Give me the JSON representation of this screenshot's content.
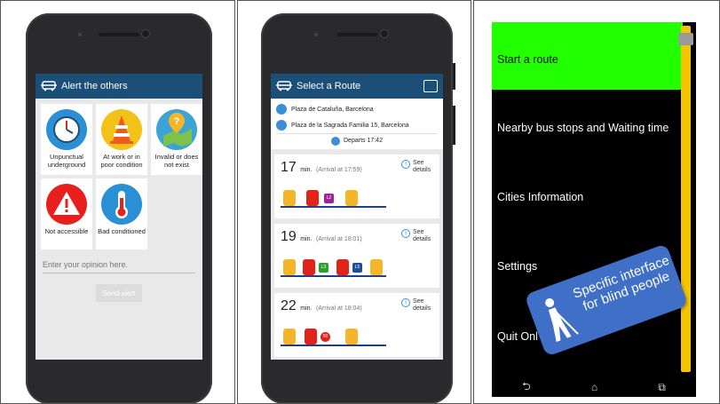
{
  "panel1": {
    "appbar_title": "Alert the others",
    "tiles": [
      {
        "label": "Unpunctual underground",
        "icon": "clock-icon",
        "color": "#2a8fd4"
      },
      {
        "label": "At work or in poor condition",
        "icon": "traffic-cone-icon",
        "color": "#f2c219"
      },
      {
        "label": "Invalid or does not exist",
        "icon": "map-question-icon",
        "color": "#3ba4d4"
      },
      {
        "label": "Not accessible",
        "icon": "warning-icon",
        "color": "#e8201d"
      },
      {
        "label": "Bad conditioned",
        "icon": "thermometer-icon",
        "color": "#2a8fd4"
      }
    ],
    "opinion_placeholder": "Enter your opinion here.",
    "send_label": "Send alert"
  },
  "panel2": {
    "appbar_title": "Select a Route",
    "origin": "Plaza de Cataluña, Barcelona",
    "destination": "Plaza de la Sagrada Familia 15, Barcelona",
    "departs": "Departs 17:42",
    "routes": [
      {
        "minutes": "17",
        "unit": "min.",
        "arrival": "(Arrival at 17:59)",
        "see": "See details",
        "lines": [
          "L2"
        ]
      },
      {
        "minutes": "19",
        "unit": "min.",
        "arrival": "(Arrival at 18:01)",
        "see": "See details",
        "lines": [
          "L3",
          "L5"
        ]
      },
      {
        "minutes": "22",
        "unit": "min.",
        "arrival": "(Arrival at 18:04)",
        "see": "See details",
        "lines": [
          "50"
        ]
      }
    ]
  },
  "panel3": {
    "menu": [
      "Start a route",
      "Nearby bus stops and Waiting time",
      "Cities Information",
      "Settings",
      "Quit Onl"
    ],
    "callout": "Specific interface for blind people",
    "nav": {
      "back": "back-icon",
      "home": "home-icon",
      "recents": "recents-icon"
    },
    "colors": {
      "active": "#22ff00",
      "scrollbar": "#f5c400",
      "callout": "#3f6fc6"
    }
  }
}
